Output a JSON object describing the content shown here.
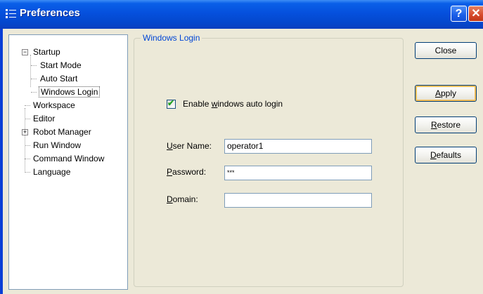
{
  "window": {
    "title": "Preferences"
  },
  "titlebar_buttons": {
    "help": "?",
    "close": "✕"
  },
  "tree": {
    "items": [
      {
        "label": "Startup",
        "expander": "−"
      },
      {
        "label": "Start Mode"
      },
      {
        "label": "Auto Start"
      },
      {
        "label": "Windows Login",
        "selected": true
      },
      {
        "label": "Workspace"
      },
      {
        "label": "Editor"
      },
      {
        "label": "Robot Manager",
        "expander": "+"
      },
      {
        "label": "Run Window"
      },
      {
        "label": "Command Window"
      },
      {
        "label": "Language"
      }
    ]
  },
  "group": {
    "title": "Windows Login",
    "checkbox": {
      "label_pre": "Enable ",
      "label_key": "w",
      "label_post": "indows auto login",
      "checked": true
    },
    "fields": [
      {
        "key": "U",
        "rest": "ser Name:",
        "value": "operator1"
      },
      {
        "key": "P",
        "rest": "assword:",
        "value": "***"
      },
      {
        "key": "D",
        "rest": "omain:",
        "value": ""
      }
    ]
  },
  "buttons": {
    "close": "Close",
    "apply": {
      "key": "A",
      "rest": "pply"
    },
    "restore": {
      "key": "R",
      "rest": "estore"
    },
    "defaults": {
      "key": "D",
      "rest": "efaults"
    }
  },
  "colors": {
    "title_blue": "#0550dd",
    "group_title": "#0046d5",
    "check_green": "#21a121"
  },
  "icons": {
    "window": "preferences-list-icon"
  }
}
